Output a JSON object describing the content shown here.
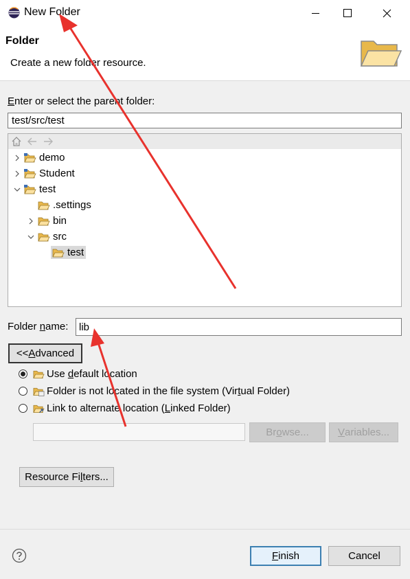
{
  "window": {
    "title": "New Folder",
    "icon": "eclipse-icon",
    "controls": {
      "minimize": "minimize-icon",
      "maximize": "maximize-icon",
      "close": "close-icon"
    }
  },
  "header": {
    "title": "Folder",
    "description": "Create a new folder resource.",
    "icon": "folder-wizard-banner-icon"
  },
  "parent": {
    "label_pre": "",
    "label_mnemonic": "E",
    "label_post": "nter or select the parent folder:",
    "value": "test/src/test"
  },
  "tree": {
    "toolbar_icons": [
      "home-icon",
      "back-icon",
      "forward-icon"
    ],
    "nodes": [
      {
        "label": "demo",
        "expanded": false,
        "depth": 0,
        "type": "project"
      },
      {
        "label": "Student",
        "expanded": false,
        "depth": 0,
        "type": "project"
      },
      {
        "label": "test",
        "expanded": true,
        "depth": 0,
        "type": "project"
      },
      {
        "label": ".settings",
        "expanded": null,
        "depth": 1,
        "type": "folder"
      },
      {
        "label": "bin",
        "expanded": false,
        "depth": 1,
        "type": "folder"
      },
      {
        "label": "src",
        "expanded": true,
        "depth": 1,
        "type": "folder"
      },
      {
        "label": "test",
        "expanded": null,
        "depth": 2,
        "type": "folder",
        "selected": true
      }
    ]
  },
  "folder_name": {
    "label_pre": "Folder ",
    "label_mnemonic": "n",
    "label_post": "ame:",
    "value": "lib"
  },
  "advanced_button": {
    "pre": "<< ",
    "mnemonic": "A",
    "post": "dvanced"
  },
  "location_options": [
    {
      "pre": "Use ",
      "mnemonic": "d",
      "post": "efault location",
      "selected": true
    },
    {
      "pre": "Folder is not located in the file system (Vir",
      "mnemonic": "t",
      "post": "ual Folder)",
      "selected": false
    },
    {
      "pre": "Link to alternate location (",
      "mnemonic": "L",
      "post": "inked Folder)",
      "selected": false
    }
  ],
  "linked_location": {
    "value": "",
    "browse": {
      "pre": "Br",
      "mnemonic": "o",
      "post": "wse..."
    },
    "variables": {
      "pre": "",
      "mnemonic": "V",
      "post": "ariables..."
    }
  },
  "resource_filters_button": {
    "pre": "Resource Fi",
    "mnemonic": "l",
    "post": "ters..."
  },
  "footer": {
    "help_icon": "help-icon",
    "finish": {
      "pre": "",
      "mnemonic": "F",
      "post": "inish"
    },
    "cancel": "Cancel"
  },
  "colors": {
    "accent": "#3c7fb1",
    "folder_yellow": "#f5c15a",
    "annotation_red": "#e8322d"
  }
}
